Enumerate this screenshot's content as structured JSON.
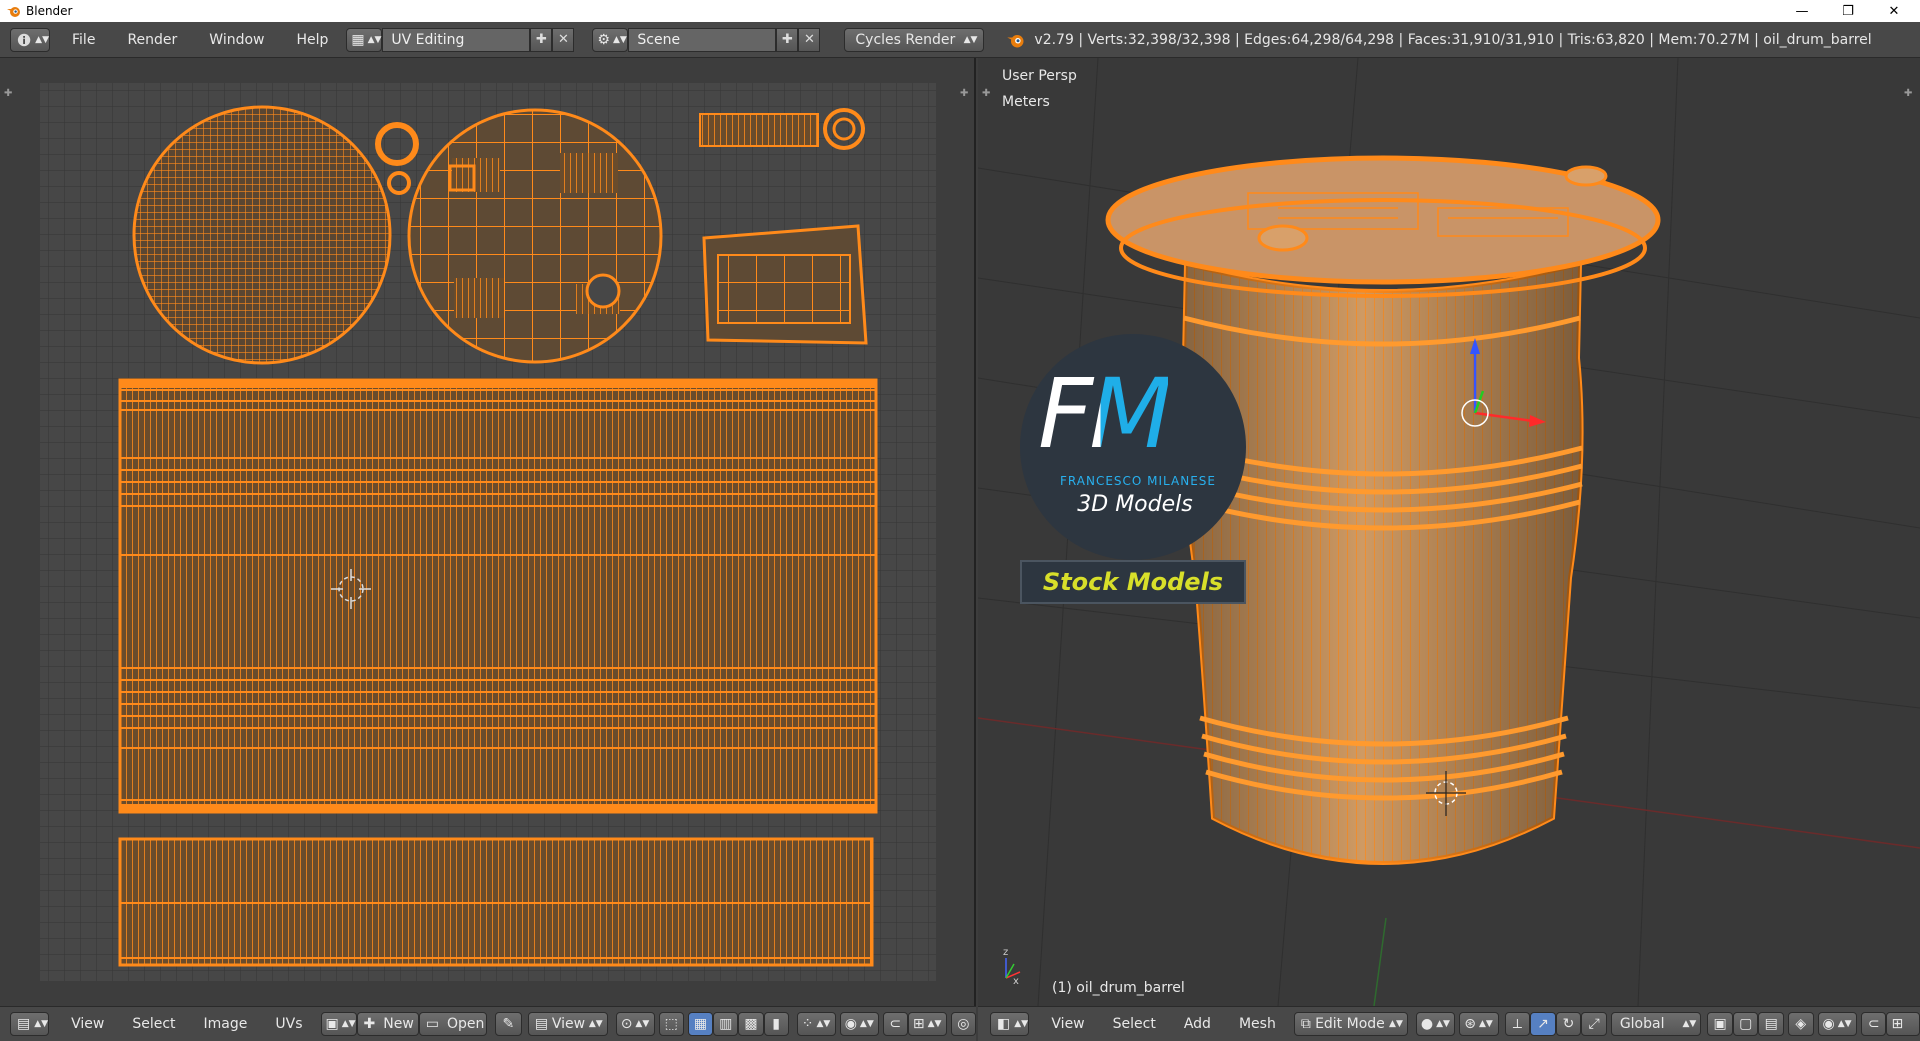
{
  "window": {
    "title": "Blender",
    "minimize": "—",
    "restore": "❐",
    "close": "✕"
  },
  "info_header": {
    "menus": [
      "File",
      "Render",
      "Window",
      "Help"
    ],
    "layout_name": "UV Editing",
    "scene_name": "Scene",
    "render_engine": "Cycles Render",
    "stats": "v2.79 | Verts:32,398/32,398 | Edges:64,298/64,298 | Faces:31,910/31,910 | Tris:63,820 | Mem:70.27M | oil_drum_barrel"
  },
  "uv_editor": {
    "menus": [
      "View",
      "Select",
      "Image",
      "UVs"
    ],
    "new_label": "New",
    "open_label": "Open",
    "view_label": "View"
  },
  "viewport": {
    "view_name": "User Persp",
    "units": "Meters",
    "object_label": "(1) oil_drum_barrel",
    "menus": [
      "View",
      "Select",
      "Add",
      "Mesh"
    ],
    "mode": "Edit Mode",
    "orientation": "Global"
  },
  "watermark": {
    "monogram": "FM",
    "author": "FRANCESCO MILANESE",
    "tagline": "3D Models",
    "banner": "Stock Models"
  },
  "colors": {
    "uv_wire": "#ff8a1a",
    "accent": "#e07b1b",
    "bg": "#3d3d3d"
  }
}
